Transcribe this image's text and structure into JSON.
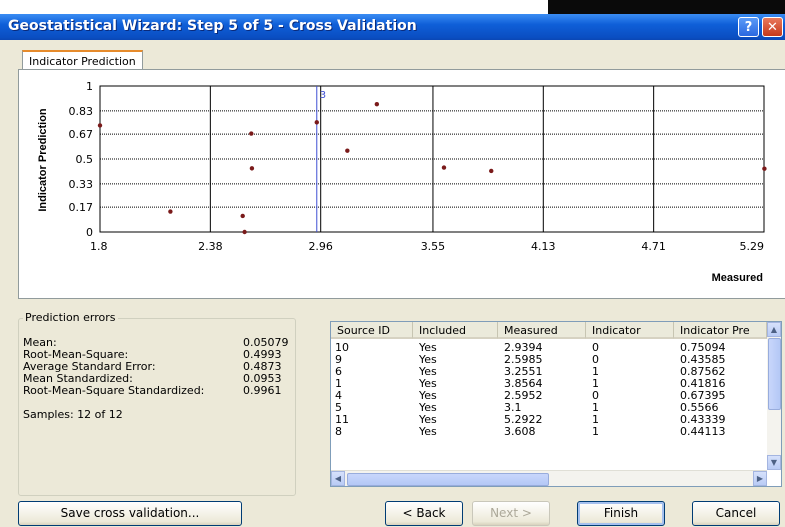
{
  "window": {
    "title": "Geostatistical Wizard: Step 5 of 5 - Cross Validation",
    "help_glyph": "?",
    "close_glyph": "✕"
  },
  "tab": {
    "label": "Indicator Prediction"
  },
  "chart_data": {
    "type": "scatter",
    "xlabel": "Measured",
    "ylabel": "Indicator Prediction",
    "xlim": [
      1.8,
      5.29
    ],
    "ylim": [
      0,
      1
    ],
    "xticks": [
      "1.8",
      "2.38",
      "2.96",
      "3.55",
      "4.13",
      "4.71",
      "5.29"
    ],
    "yticks": [
      "0",
      "0.17",
      "0.33",
      "0.5",
      "0.67",
      "0.83",
      "1"
    ],
    "grid": true,
    "selected": {
      "x": 2.9394,
      "label": "3"
    },
    "points": [
      {
        "x": 2.9394,
        "y": 0.75094
      },
      {
        "x": 2.5985,
        "y": 0.43585
      },
      {
        "x": 3.2551,
        "y": 0.87562
      },
      {
        "x": 3.8564,
        "y": 0.41816
      },
      {
        "x": 2.5952,
        "y": 0.67395
      },
      {
        "x": 3.1,
        "y": 0.5566
      },
      {
        "x": 5.2922,
        "y": 0.43339
      },
      {
        "x": 3.608,
        "y": 0.44113
      },
      {
        "x": 1.8,
        "y": 0.73
      },
      {
        "x": 2.17,
        "y": 0.14
      },
      {
        "x": 2.55,
        "y": 0.11
      },
      {
        "x": 2.56,
        "y": 0.0
      }
    ],
    "point_color": "#7a1a1a",
    "selected_line_color": "#3e4fd4"
  },
  "prediction_errors": {
    "caption": "Prediction errors",
    "rows": [
      {
        "label": "Mean:",
        "value": "0.05079"
      },
      {
        "label": "Root-Mean-Square:",
        "value": "0.4993"
      },
      {
        "label": "Average Standard Error:",
        "value": "0.4873"
      },
      {
        "label": "Mean Standardized:",
        "value": "0.0953"
      },
      {
        "label": "Root-Mean-Square Standardized:",
        "value": "0.9961"
      }
    ],
    "samples": "Samples: 12 of 12"
  },
  "table": {
    "columns": [
      "Source ID",
      "Included",
      "Measured",
      "Indicator",
      "Indicator Pre"
    ],
    "rows": [
      [
        "10",
        "Yes",
        "2.9394",
        "0",
        "0.75094"
      ],
      [
        "9",
        "Yes",
        "2.5985",
        "0",
        "0.43585"
      ],
      [
        "6",
        "Yes",
        "3.2551",
        "1",
        "0.87562"
      ],
      [
        "1",
        "Yes",
        "3.8564",
        "1",
        "0.41816"
      ],
      [
        "4",
        "Yes",
        "2.5952",
        "0",
        "0.67395"
      ],
      [
        "5",
        "Yes",
        "3.1",
        "1",
        "0.5566"
      ],
      [
        "11",
        "Yes",
        "5.2922",
        "1",
        "0.43339"
      ],
      [
        "8",
        "Yes",
        "3.608",
        "1",
        "0.44113"
      ]
    ]
  },
  "buttons": {
    "save": "Save cross validation...",
    "back": "< Back",
    "next": "Next >",
    "finish": "Finish",
    "cancel": "Cancel"
  }
}
